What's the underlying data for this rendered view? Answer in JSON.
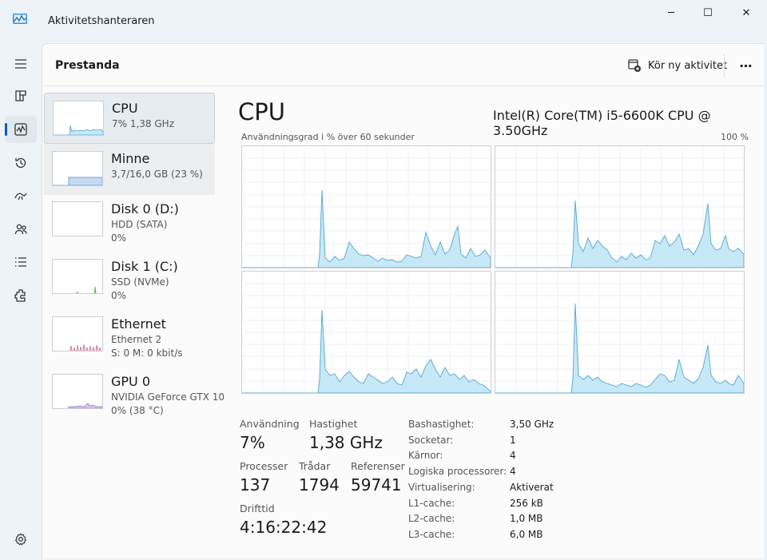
{
  "window": {
    "title": "Aktivitetshanteraren",
    "controls": [
      "─",
      "☐",
      "✕"
    ]
  },
  "header": {
    "title": "Prestanda",
    "run_task_label": "Kör ny aktivitet",
    "more_label": "⋯"
  },
  "resources": [
    {
      "name": "CPU",
      "line1": "7% 1,38 GHz",
      "line2": ""
    },
    {
      "name": "Minne",
      "line1": "3,7/16,0 GB (23 %)",
      "line2": ""
    },
    {
      "name": "Disk 0 (D:)",
      "line1": "HDD (SATA)",
      "line2": "0%"
    },
    {
      "name": "Disk 1 (C:)",
      "line1": "SSD (NVMe)",
      "line2": "0%"
    },
    {
      "name": "Ethernet",
      "line1": "Ethernet 2",
      "line2": "S: 0 M: 0 kbit/s"
    },
    {
      "name": "GPU 0",
      "line1": "NVIDIA GeForce GTX 10",
      "line2": "0% (38 °C)"
    }
  ],
  "details": {
    "title": "CPU",
    "model": "Intel(R) Core(TM) i5-6600K CPU @ 3.50GHz",
    "graph_label": "Användningsgrad i % över 60 sekunder",
    "graph_max": "100 %",
    "usage_label": "Användning",
    "usage_value": "7%",
    "speed_label": "Hastighet",
    "speed_value": "1,38 GHz",
    "processes_label": "Processer",
    "processes_value": "137",
    "threads_label": "Trådar",
    "threads_value": "1794",
    "handles_label": "Referenser",
    "handles_value": "59741",
    "uptime_label": "Drifttid",
    "uptime_value": "4:16:22:42",
    "specs": [
      {
        "label": "Bashastighet:",
        "value": "3,50 GHz"
      },
      {
        "label": "Socketar:",
        "value": "1"
      },
      {
        "label": "Kärnor:",
        "value": "4"
      },
      {
        "label": "Logiska processorer:",
        "value": "4"
      },
      {
        "label": "Virtualisering:",
        "value": "Aktiverat"
      },
      {
        "label": "L1-cache:",
        "value": "256 kB"
      },
      {
        "label": "L2-cache:",
        "value": "1,0 MB"
      },
      {
        "label": "L3-cache:",
        "value": "6,0 MB"
      }
    ]
  },
  "colors": {
    "accent": "#005fb8",
    "cpu_fill": "#c7e8f6",
    "cpu_line": "#4ea8d2",
    "memory_fill": "#c5daf3",
    "memory_line": "#5a8fd0",
    "disk_line": "#4caf50",
    "ethernet_line": "#d46a9a",
    "gpu_line": "#9c6ed0"
  },
  "icons": {
    "app": "task-manager-icon",
    "rail": [
      "hamburger-icon",
      "processes-icon",
      "performance-icon",
      "app-history-icon",
      "startup-apps-icon",
      "users-icon",
      "details-icon",
      "services-icon",
      "settings-icon"
    ],
    "run_task": "run-new-task-icon"
  }
}
